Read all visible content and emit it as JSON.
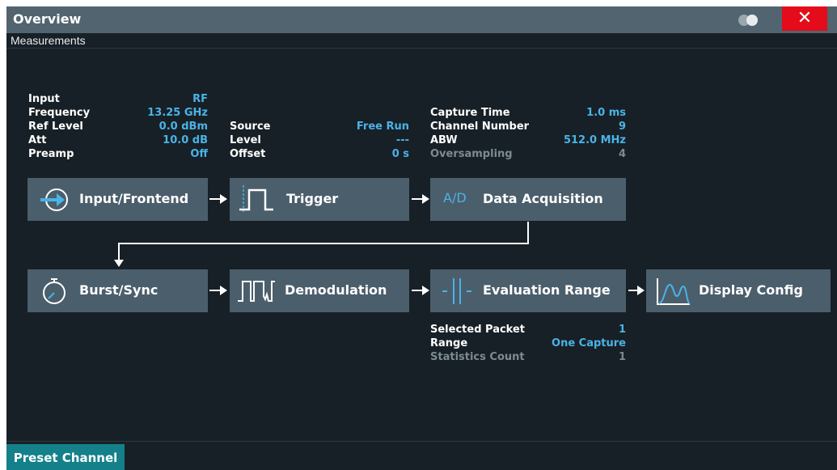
{
  "window": {
    "title": "Overview",
    "close_label": "✕"
  },
  "section_label": "Measurements",
  "input_info": [
    {
      "key": "Input",
      "value": "RF"
    },
    {
      "key": "Frequency",
      "value": "13.25 GHz"
    },
    {
      "key": "Ref Level",
      "value": "0.0 dBm"
    },
    {
      "key": "Att",
      "value": "10.0 dB"
    },
    {
      "key": "Preamp",
      "value": "Off"
    }
  ],
  "trigger_info": [
    {
      "key": "Source",
      "value": "Free Run"
    },
    {
      "key": "Level",
      "value": "---"
    },
    {
      "key": "Offset",
      "value": "0 s"
    }
  ],
  "acq_info": [
    {
      "key": "Capture Time",
      "value": "1.0 ms"
    },
    {
      "key": "Channel Number",
      "value": "9"
    },
    {
      "key": "ABW",
      "value": "512.0 MHz"
    },
    {
      "key": "Oversampling",
      "value": "4"
    }
  ],
  "eval_info": [
    {
      "key": "Selected Packet",
      "value": "1"
    },
    {
      "key": "Range",
      "value": "One Capture"
    },
    {
      "key": "Statistics Count",
      "value": "1"
    }
  ],
  "blocks": {
    "input_frontend": {
      "label": "Input/Frontend",
      "icon": "input-arrow-icon"
    },
    "trigger": {
      "label": "Trigger",
      "icon": "trigger-pulse-icon"
    },
    "data_acquisition": {
      "label": "Data Acquisition",
      "icon_text": "A/D",
      "icon": "ad-converter-icon"
    },
    "burst_sync": {
      "label": "Burst/Sync",
      "icon": "stopwatch-icon"
    },
    "demodulation": {
      "label": "Demodulation",
      "icon": "pulse-train-icon"
    },
    "evaluation_range": {
      "label": "Evaluation Range",
      "icon": "range-marker-icon"
    },
    "display_config": {
      "label": "Display Config",
      "icon": "spectrum-trace-icon"
    }
  },
  "footer": {
    "preset_label": "Preset Channel"
  },
  "colors": {
    "title_bar": "#52646f",
    "background": "#172026",
    "block": "#4b5e6b",
    "value_blue": "#4ab3e8",
    "close_red": "#e40b1a",
    "preset_teal": "#14808a"
  }
}
